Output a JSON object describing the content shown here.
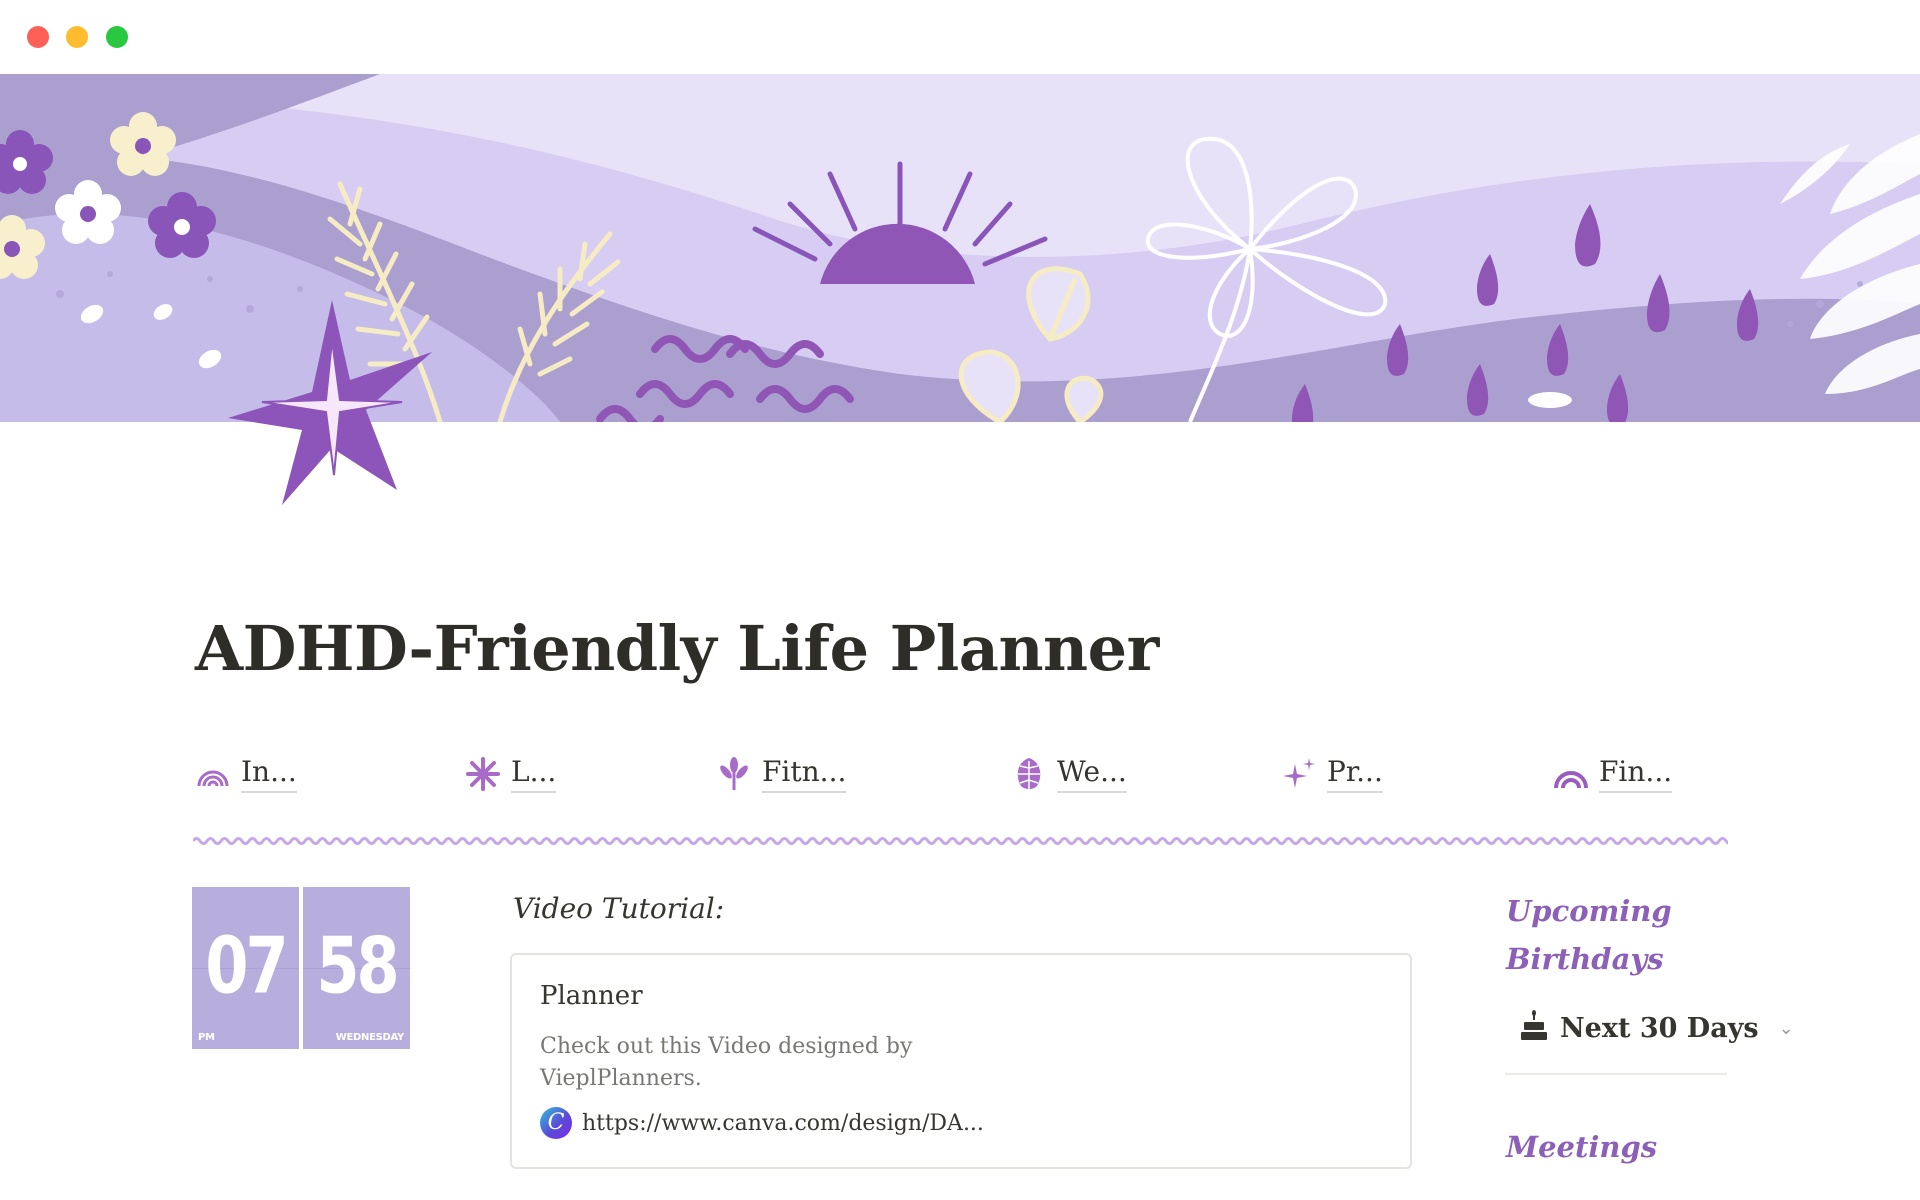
{
  "window": {
    "controls": [
      "close",
      "minimize",
      "maximize"
    ]
  },
  "cover": {
    "theme": "lavender hills with sun, flowers and raindrops"
  },
  "page": {
    "icon": "purple-star-icon",
    "title": "ADHD-Friendly Life Planner"
  },
  "nav_links": [
    {
      "label": "In...",
      "icon": "rainbow-icon"
    },
    {
      "label": "L...",
      "icon": "flower-burst-icon"
    },
    {
      "label": "Fitn...",
      "icon": "sprout-icon"
    },
    {
      "label": "We...",
      "icon": "monstera-leaf-icon"
    },
    {
      "label": "Pr...",
      "icon": "sparkles-icon"
    },
    {
      "label": "Fin...",
      "icon": "rainbow-icon"
    }
  ],
  "clock": {
    "hour": "07",
    "minute": "58",
    "period": "PM",
    "weekday": "WEDNESDAY"
  },
  "video": {
    "heading": "Video Tutorial:",
    "bookmark_title": "Planner",
    "bookmark_description": "Check out this Video designed by VieplPlanners.",
    "bookmark_url": "https://www.canva.com/design/DA...",
    "bookmark_favicon": "canva-icon"
  },
  "sidebar": {
    "birthdays_heading": "Upcoming Birthdays",
    "birthdays_filter": "Next 30 Days",
    "birthdays_filter_icon": "birthday-cake-icon",
    "meetings_heading": "Meetings"
  },
  "colors": {
    "accent_purple": "#8c5fb8",
    "cover_light": "#e8e2f8",
    "cover_mid": "#aa9fcf",
    "clock_tile": "#b8aede"
  }
}
